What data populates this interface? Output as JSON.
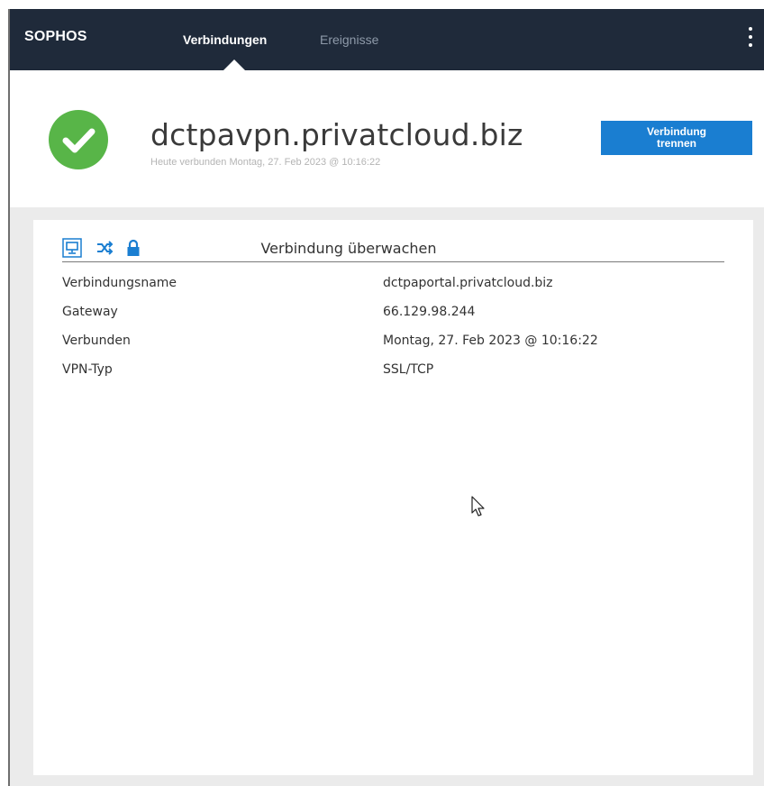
{
  "nav": {
    "logo": "SOPHOS",
    "tabs": [
      {
        "label": "Verbindungen",
        "active": true
      },
      {
        "label": "Ereignisse",
        "active": false
      }
    ],
    "menu_icon": "more-vertical-icon"
  },
  "connection": {
    "status_icon": "check-circle-icon",
    "status_color": "#58b548",
    "hostname": "dctpavpn.privatcloud.biz",
    "connected_since": "Heute verbunden Montag, 27. Feb 2023 @ 10:16:22",
    "disconnect_label_line1": "Verbindung",
    "disconnect_label_line2": "trennen"
  },
  "panel": {
    "title": "Verbindung überwachen",
    "toolbar_icons": [
      "monitor-icon",
      "shuffle-icon",
      "lock-icon"
    ],
    "rows": [
      {
        "label": "Verbindungsname",
        "value": "dctpaportal.privatcloud.biz"
      },
      {
        "label": "Gateway",
        "value": "66.129.98.244"
      },
      {
        "label": "Verbunden",
        "value": "Montag, 27. Feb 2023 @ 10:16:22"
      },
      {
        "label": "VPN-Typ",
        "value": "SSL/TCP"
      }
    ]
  },
  "colors": {
    "navbar": "#1f2a3a",
    "accent": "#1a7ed1",
    "success": "#58b548"
  }
}
